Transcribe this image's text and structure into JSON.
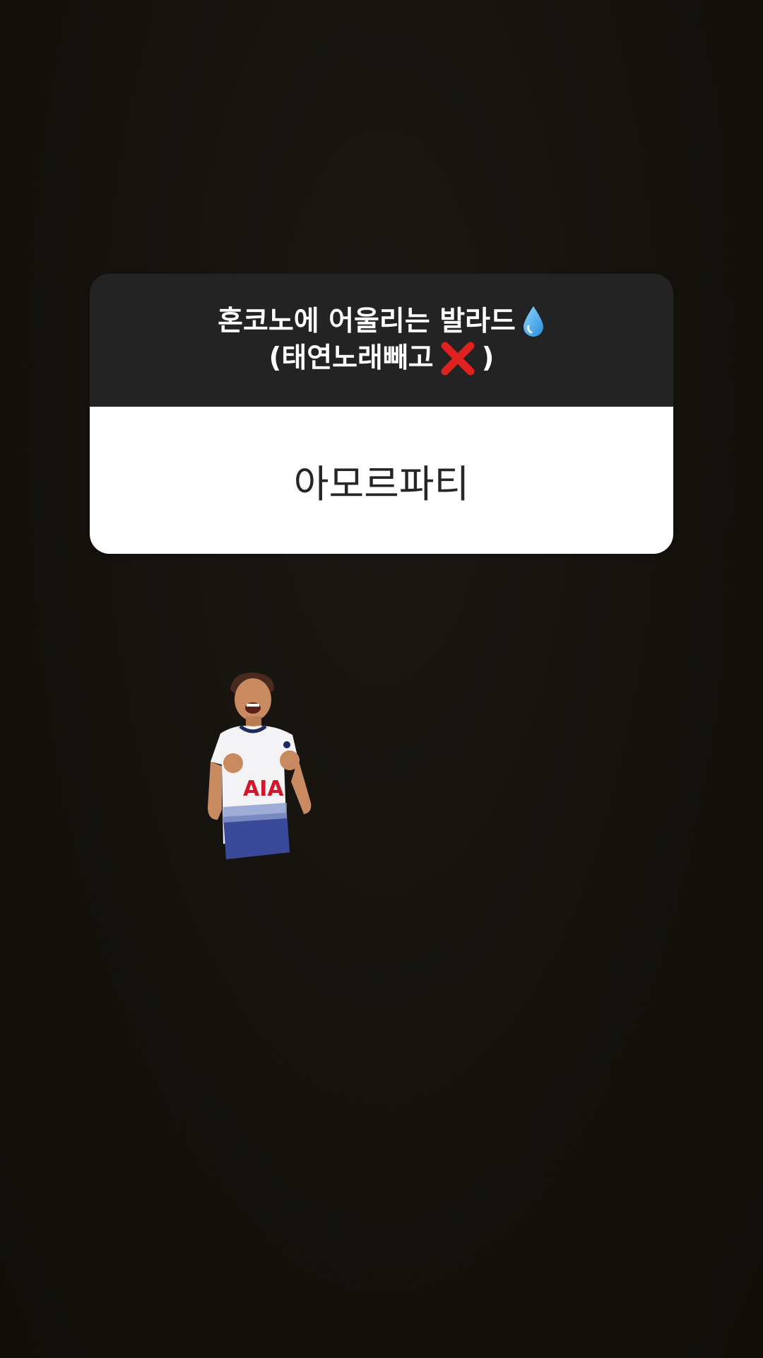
{
  "story": {
    "background_color": "#17140f"
  },
  "question_card": {
    "question_line1": "혼코노에 어울리는 발라드",
    "question_line2_open": "(태연노래빼고",
    "question_line2_close": ")",
    "answer": "아모르파티",
    "emoji_drop": "droplet-icon",
    "emoji_cross": "cross-mark-icon",
    "question_bg": "#232323",
    "answer_bg": "#ffffff"
  },
  "sticker": {
    "name": "celebrating-footballer-sticker",
    "shirt_text": "AIA"
  }
}
